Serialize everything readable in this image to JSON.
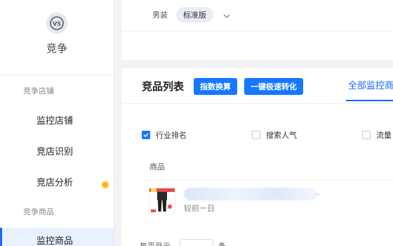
{
  "sidebar": {
    "brand": {
      "logo_text": "VS",
      "title": "竞争"
    },
    "groups": [
      {
        "title": "竞争店铺",
        "items": [
          {
            "label": "监控店铺"
          },
          {
            "label": "竞店识别"
          },
          {
            "label": "竞店分析"
          }
        ]
      },
      {
        "title": "竞争商品",
        "items": [
          {
            "label": "监控商品"
          }
        ]
      }
    ],
    "active_item": "监控商品",
    "notification_color": "#ffb020"
  },
  "top": {
    "category": "男装",
    "version": "标准版"
  },
  "main": {
    "title": "竞品列表",
    "buttons": {
      "index_convert": "指数换算",
      "quick_convert": "一键极速转化"
    },
    "tab": "全部监控商",
    "filters": [
      {
        "label": "行业排名",
        "checked": true
      },
      {
        "label": "搜索人气",
        "checked": false
      },
      {
        "label": "流量",
        "checked": false
      }
    ],
    "table": {
      "column": "商品",
      "rows": [
        {
          "name_blurred": true,
          "ellipsis": "..",
          "compare": "较前一日"
        }
      ]
    },
    "pager": {
      "label": "每页显示",
      "unit": "条"
    }
  },
  "colors": {
    "accent": "#1677ff",
    "active_bg": "#e9f1ff"
  }
}
